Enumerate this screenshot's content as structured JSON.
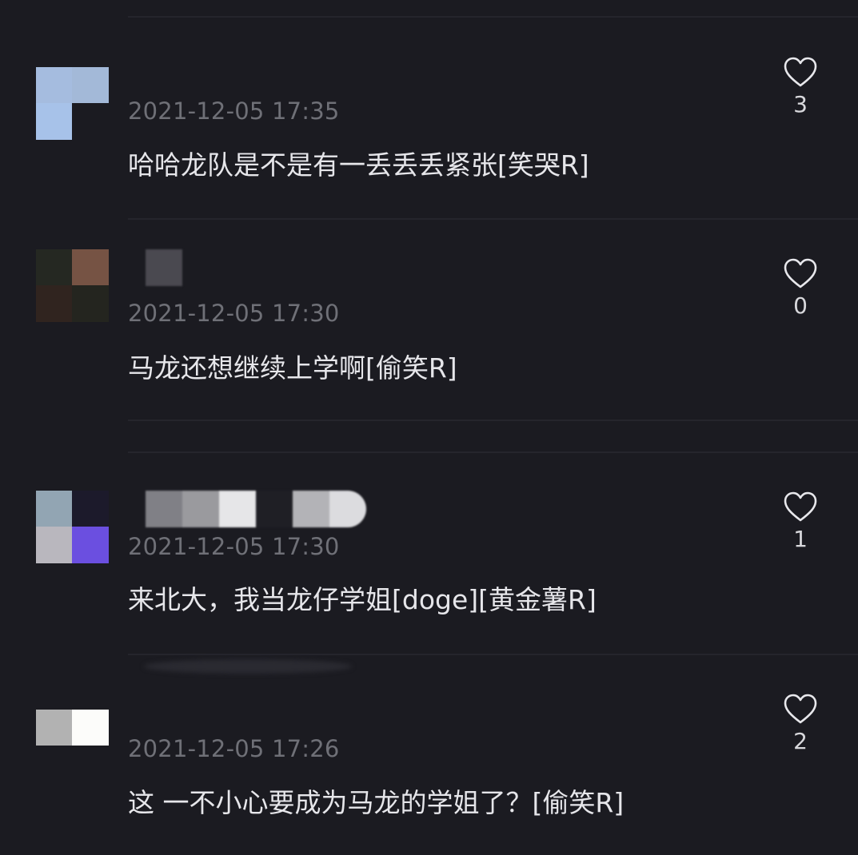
{
  "comments": [
    {
      "timestamp": "2021-12-05 17:35",
      "text": "哈哈龙队是不是有一丢丢丢紧张[笑哭R]",
      "likes": "3",
      "avatar_colors": [
        "#a5bcdf",
        "#a3b9d8",
        "#a7c2e9",
        "#1b1b21"
      ]
    },
    {
      "timestamp": "2021-12-05 17:30",
      "text": "马龙还想继续上学啊[偷笑R]",
      "likes": "0",
      "avatar_colors": [
        "#252822",
        "#765344",
        "#30241f",
        "#24251f"
      ],
      "name_blur_colors": [
        "#4a4950"
      ]
    },
    {
      "timestamp": "2021-12-05 17:30",
      "text": "来北大，我当龙仔学姐[doge][黄金薯R]",
      "likes": "1",
      "avatar_colors": [
        "#92a5b3",
        "#1c1a2b",
        "#b9b7be",
        "#6b4fe0"
      ],
      "name_blur_colors": [
        "#808086",
        "#9a9a9e",
        "#e6e6e8",
        "#1f1f25",
        "#b3b3b7",
        "#dcdcdf"
      ]
    },
    {
      "timestamp": "2021-12-05 17:26",
      "text": "这 一不小心要成为马龙的学姐了？[偷笑R]",
      "likes": "2",
      "avatar_colors": [
        "#b2b2b2",
        "#fcfcfa",
        "#1b1b21",
        "#1b1b21"
      ]
    }
  ]
}
